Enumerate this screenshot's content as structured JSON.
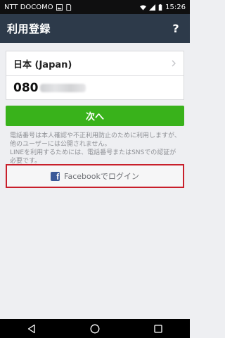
{
  "status_bar": {
    "carrier": "NTT DOCOMO",
    "time": "15:26",
    "icons": [
      "image-notification-icon",
      "sim-icon",
      "wifi-icon",
      "signal-icon",
      "battery-icon"
    ]
  },
  "app_bar": {
    "title": "利用登録",
    "help_label": "?"
  },
  "form": {
    "country_label": "日本 (Japan)",
    "phone_prefix": "080",
    "chevron_icon": "chevron-right-icon"
  },
  "actions": {
    "next_label": "次へ",
    "facebook_label": "Facebookでログイン",
    "facebook_icon_glyph": "f"
  },
  "notice": {
    "line1": "電話番号は本人確認や不正利用防止のために利用しますが、他のユーザーには公開されません。",
    "line2": "LINEを利用するためには、電話番号またはSNSでの認証が必要です。"
  },
  "colors": {
    "app_bar": "#2d3a4a",
    "next_button": "#39b21b",
    "facebook_blue": "#3b5998",
    "highlight_border": "#c81f2b"
  }
}
